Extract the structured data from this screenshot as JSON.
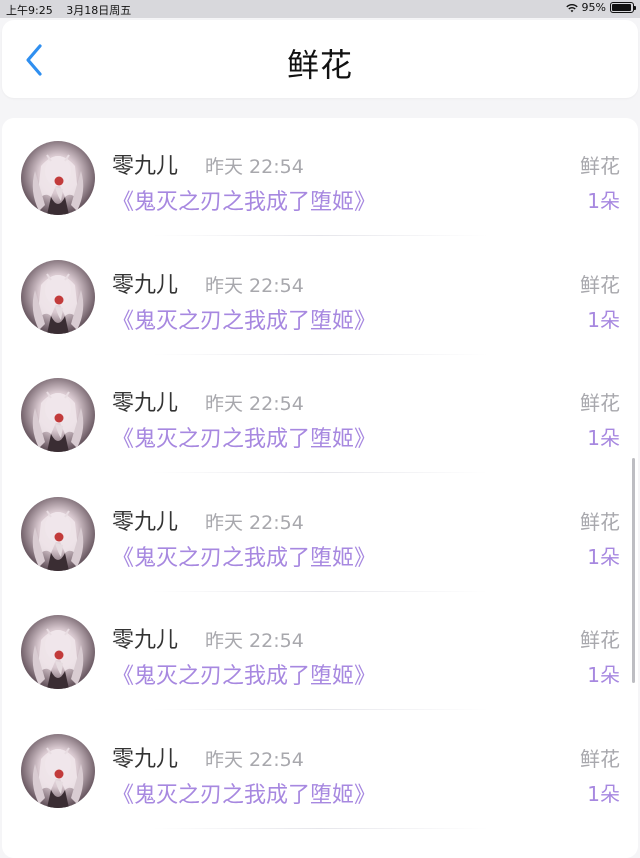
{
  "status_bar": {
    "time": "上午9:25",
    "date": "3月18日周五",
    "battery": "95%",
    "battery_level": 0.95,
    "wifi_icon": "wifi-icon",
    "battery_icon": "battery-icon"
  },
  "header": {
    "title": "鲜花",
    "back_icon": "chevron-left-icon",
    "accent_color": "#2f8ff0"
  },
  "colors": {
    "accent_purple": "#a788e0",
    "muted_gray": "#a8a8ad"
  },
  "rows": [
    {
      "username": "零九儿",
      "time": "昨天 22:54",
      "book": "《鬼灭之刃之我成了堕姬》",
      "gift_type": "鲜花",
      "gift_count": "1朵"
    },
    {
      "username": "零九儿",
      "time": "昨天 22:54",
      "book": "《鬼灭之刃之我成了堕姬》",
      "gift_type": "鲜花",
      "gift_count": "1朵"
    },
    {
      "username": "零九儿",
      "time": "昨天 22:54",
      "book": "《鬼灭之刃之我成了堕姬》",
      "gift_type": "鲜花",
      "gift_count": "1朵"
    },
    {
      "username": "零九儿",
      "time": "昨天 22:54",
      "book": "《鬼灭之刃之我成了堕姬》",
      "gift_type": "鲜花",
      "gift_count": "1朵"
    },
    {
      "username": "零九儿",
      "time": "昨天 22:54",
      "book": "《鬼灭之刃之我成了堕姬》",
      "gift_type": "鲜花",
      "gift_count": "1朵"
    },
    {
      "username": "零九儿",
      "time": "昨天 22:54",
      "book": "《鬼灭之刃之我成了堕姬》",
      "gift_type": "鲜花",
      "gift_count": "1朵"
    }
  ]
}
